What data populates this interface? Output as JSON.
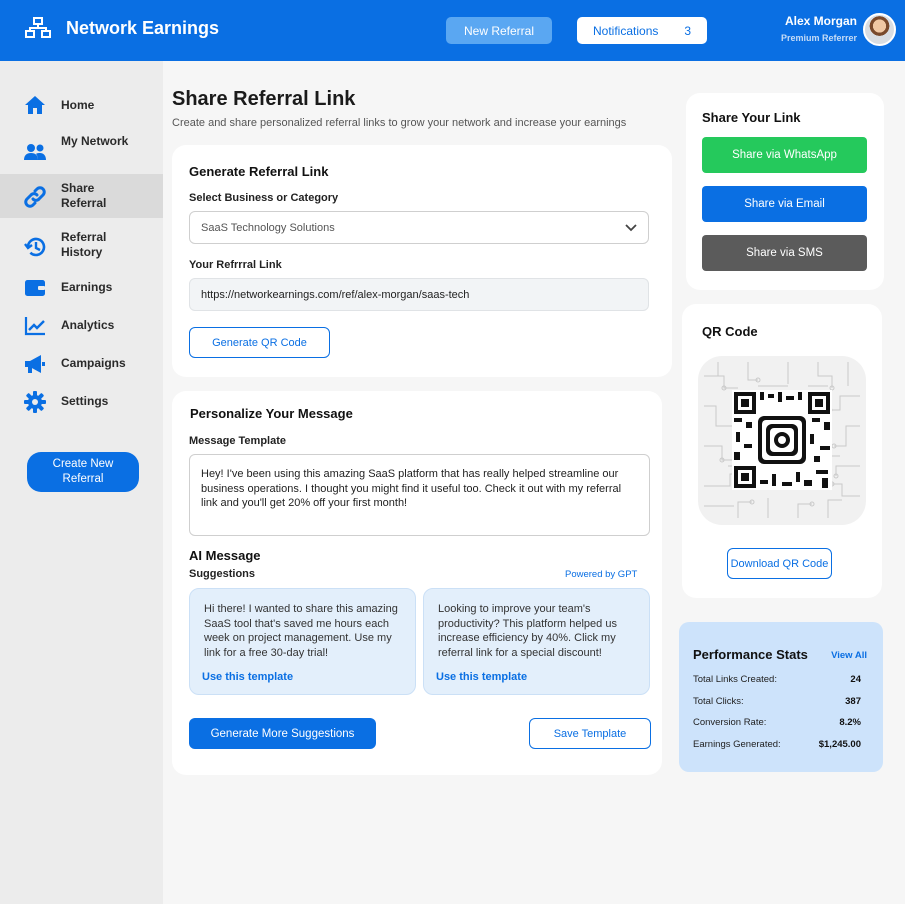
{
  "header": {
    "app_title": "Network Earnings",
    "new_referral_label": "New Referral",
    "notifications_label": "Notifications",
    "notifications_count": "3",
    "user_name": "Alex Morgan",
    "user_role": "Premium Referrer"
  },
  "sidebar": {
    "items": [
      {
        "label": "Home",
        "icon": "home-icon"
      },
      {
        "label": "My Network",
        "icon": "users-icon"
      },
      {
        "label": "Share Referral",
        "icon": "link-icon",
        "active": true
      },
      {
        "label": "Referral History",
        "icon": "history-icon"
      },
      {
        "label": "Earnings",
        "icon": "wallet-icon"
      },
      {
        "label": "Analytics",
        "icon": "chart-icon"
      },
      {
        "label": "Campaigns",
        "icon": "megaphone-icon"
      },
      {
        "label": "Settings",
        "icon": "gear-icon"
      }
    ],
    "create_button": "Create New Referral"
  },
  "main": {
    "title": "Share Referral Link",
    "subtitle": "Create and share personalized referral links to grow your network and increase your earnings",
    "generate": {
      "title": "Generate Referral Link",
      "select_label": "Select Business or Category",
      "select_value": "SaaS Technology Solutions",
      "link_label": "Your Refrrral Link",
      "link_value": "https://networkearnings.com/ref/alex-morgan/saas-tech",
      "qr_button": "Generate QR Code"
    },
    "personalize": {
      "title": "Personalize Your Message",
      "template_label": "Message Template",
      "template_text": "Hey! I've been using this amazing SaaS platform that has really helped streamline our business operations. I thought you might find it useful too. Check it out with my referral link and you'll get 20% off your first month!",
      "ai_title": "AI Message",
      "ai_sub": "Suggestions",
      "powered_by": "Powered by GPT",
      "suggestions": [
        {
          "text": "Hi there! I wanted to share this amazing SaaS tool that's saved me hours each week on project management. Use my link for a free 30-day trial!",
          "link": "Use this template"
        },
        {
          "text": "Looking to improve your team's productivity? This platform helped us increase efficiency by 40%. Click my referral link for a special discount!",
          "link": "Use this template"
        }
      ],
      "more_button": "Generate More Suggestions",
      "save_button": "Save Template"
    }
  },
  "share": {
    "title": "Share Your Link",
    "whatsapp": "Share via WhatsApp",
    "email": "Share via Email",
    "sms": "Share via SMS"
  },
  "qr": {
    "title": "QR Code",
    "download": "Download QR Code"
  },
  "stats": {
    "title": "Performance Stats",
    "view_all": "View All",
    "rows": [
      {
        "label": "Total Links Created:",
        "value": "24"
      },
      {
        "label": "Total Clicks:",
        "value": "387"
      },
      {
        "label": "Conversion Rate:",
        "value": "8.2%"
      },
      {
        "label": "Earnings Generated:",
        "value": "$1,245.00"
      }
    ]
  },
  "colors": {
    "brand": "#0a6fe3",
    "whatsapp": "#25c95c",
    "sms": "#5b5b5b"
  }
}
